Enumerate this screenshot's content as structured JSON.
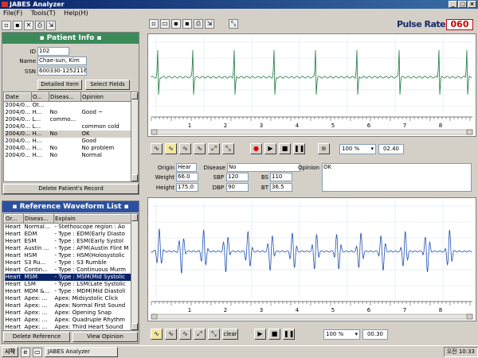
{
  "window": {
    "title": "JABES Analyzer"
  },
  "menu": [
    "File(F)",
    "Tools(T)",
    "Help(H)"
  ],
  "pulse": {
    "label": "Pulse Rate",
    "value": "060"
  },
  "patient": {
    "header": "▪ Patient Info ▪",
    "id_label": "ID",
    "id": "102",
    "name_label": "Name",
    "name": "Chae-sun, Kim",
    "ssn_label": "SSN",
    "ssn": "600330-1252116",
    "detail_btn": "Detailed Item",
    "select_btn": "Select Fields",
    "columns": [
      "Date",
      "O...",
      "Diseas...",
      "Opinion"
    ],
    "rows": [
      [
        "2004/0...",
        "Ot...",
        "",
        ""
      ],
      [
        "2004/0...",
        "H...",
        "No",
        "Good ~"
      ],
      [
        "2004/0...",
        "L...",
        "commo...",
        ""
      ],
      [
        "2004/0...",
        "L...",
        "",
        "common cold"
      ],
      [
        "2004/0...",
        "H...",
        "No",
        "OK"
      ],
      [
        "2004/0...",
        "H...",
        "",
        "Good"
      ],
      [
        "2004/0...",
        "H...",
        "No",
        "No problem"
      ],
      [
        "2004/0...",
        "H...",
        "No",
        "Normal"
      ]
    ],
    "delete_btn": "Delete Patient's Record"
  },
  "reference": {
    "header": "▪ Reference Waveform List ▪",
    "columns": [
      "Or...",
      "Diseas...",
      "Explain"
    ],
    "rows": [
      [
        "Heart",
        "Normal...",
        "- Stethoscope region : Ao"
      ],
      [
        "Heart",
        "EDM",
        "- Type : EDM(Early Diasto"
      ],
      [
        "Heart",
        "ESM",
        "- Type : ESM(Early Systol"
      ],
      [
        "Heart",
        "Austin ...",
        "- Type : AFM(Austin Flint M"
      ],
      [
        "Heart",
        "HSM",
        "- Type : HSM(Holosystolic"
      ],
      [
        "Heart",
        "S3 Ru...",
        "- Type : S3 Rumble"
      ],
      [
        "Heart",
        "Contin...",
        "- Type : Continuous Murm"
      ],
      [
        "Heart",
        "MSM",
        "- Type : MSM(Mid Systolic"
      ],
      [
        "Heart",
        "LSM",
        "- Type : LSM(Late Systolic"
      ],
      [
        "Heart",
        "MDM &...",
        "- Type : MDM(Mid Diastoli"
      ],
      [
        "Heart",
        "Apex: ...",
        "Apex: Midsystolic Click"
      ],
      [
        "Heart",
        "Apex: ...",
        "Apex: Normal First Sound"
      ],
      [
        "Heart",
        "Apex: ...",
        "Apex: Opening Snap"
      ],
      [
        "Heart",
        "Apex: ...",
        "Apex: Quadruple Rhythm"
      ],
      [
        "Heart",
        "Apex: ...",
        "Apex: Third Heart Sound"
      ]
    ],
    "delete_btn": "Delete Reference",
    "view_btn": "View Opinion"
  },
  "top_plot": {
    "zoom": "100 %",
    "time": "02.40",
    "ticks": [
      "1",
      "2",
      "3",
      "4",
      "5",
      "6",
      "7",
      "8"
    ]
  },
  "bottom_plot": {
    "zoom": "100 %",
    "time": "00.30",
    "clear": "clear",
    "ticks": [
      "1",
      "2",
      "3",
      "4",
      "5",
      "6",
      "7",
      "8"
    ]
  },
  "record": {
    "origin_label": "Origin",
    "origin": "Hear",
    "disease_label": "Disease",
    "disease": "No",
    "opinion_label": "Opinion",
    "opinion": "OK",
    "weight_label": "Weight",
    "weight": "66.0",
    "height_label": "Height",
    "height": "175.0",
    "sbp_label": "SBP",
    "sbp": "120",
    "dbp_label": "DBP",
    "dbp": "90",
    "bs_label": "BS",
    "bs": "110",
    "bt_label": "BT",
    "bt": "36.5"
  },
  "taskbar": {
    "start": "시작",
    "app": "JABES Analyzer",
    "clock": "오전 10:33"
  },
  "colors": {
    "ecg": "#1a7a3a",
    "pcg": "#2050b0",
    "title": "#0a246a",
    "panel": "#3c8a5a"
  }
}
